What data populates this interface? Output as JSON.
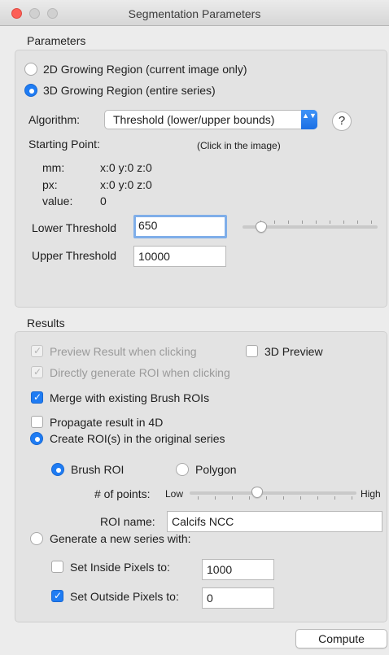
{
  "window": {
    "title": "Segmentation Parameters"
  },
  "parameters": {
    "section_label": "Parameters",
    "mode_2d": "2D Growing Region (current image only)",
    "mode_3d": "3D Growing Region (entire series)",
    "algorithm_label": "Algorithm:",
    "algorithm_value": "Threshold (lower/upper bounds)",
    "help_glyph": "?",
    "starting_point_label": "Starting Point:",
    "click_hint": "(Click in the image)",
    "mm_label": "mm:",
    "mm_value": "x:0 y:0 z:0",
    "px_label": "px:",
    "px_value": "x:0 y:0 z:0",
    "value_label": "value:",
    "value_value": "0",
    "lower_label": "Lower Threshold",
    "lower_value": "650",
    "upper_label": "Upper Threshold",
    "upper_value": "10000"
  },
  "results": {
    "section_label": "Results",
    "preview_clicking": "Preview Result when clicking",
    "preview_3d": "3D Preview",
    "direct_generate": "Directly generate ROI when clicking",
    "merge_brush": "Merge with existing Brush ROIs",
    "propagate_4d": "Propagate result in 4D",
    "create_rois": "Create ROI(s) in the original series",
    "brush_roi": "Brush ROI",
    "polygon": "Polygon",
    "points_label": "# of points:",
    "low_label": "Low",
    "high_label": "High",
    "points_level": 0.4,
    "roi_name_label": "ROI name:",
    "roi_name_value": "Calcifs NCC",
    "new_series": "Generate a new series with:",
    "inside_label": "Set Inside Pixels to:",
    "inside_value": "1000",
    "outside_label": "Set Outside Pixels to:",
    "outside_value": "0"
  },
  "footer": {
    "compute_label": "Compute"
  },
  "icons": {
    "check_glyph": "✓",
    "select_arrows": "▲▼"
  },
  "colors": {
    "accent": "#1f7cf3",
    "close": "#fc5f57"
  }
}
